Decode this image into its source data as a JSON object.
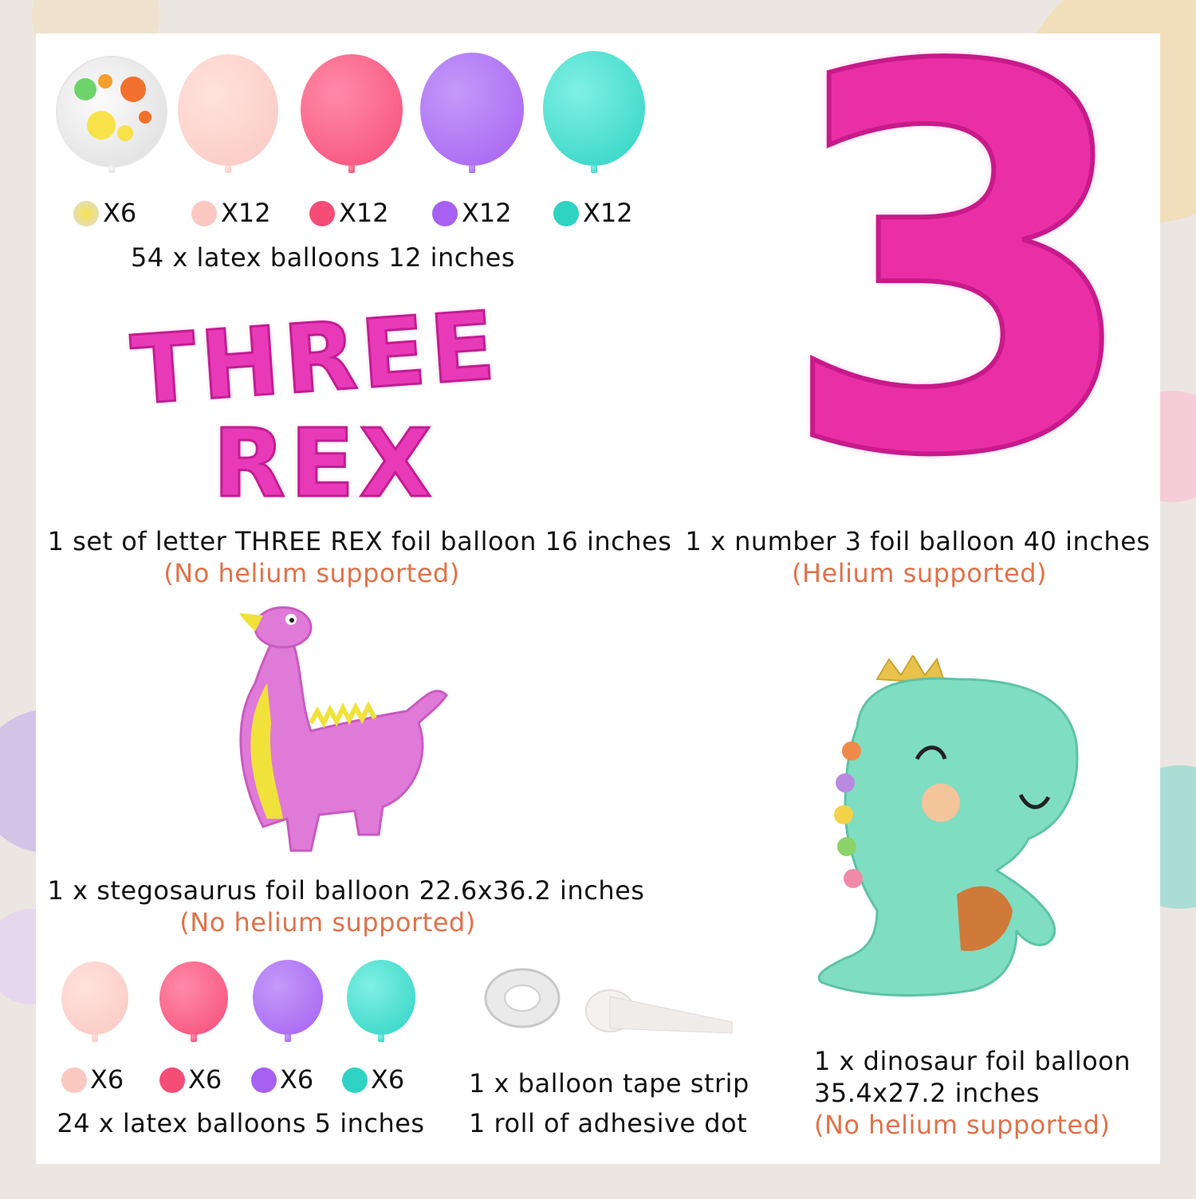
{
  "colors": {
    "peach": "#fbc8c1",
    "coral_pink": "#f64d78",
    "purple": "#a660f2",
    "teal": "#2fd3c3",
    "hot_pink": "#e83ab8",
    "note_orange": "#e0724a"
  },
  "latex12": {
    "counts": [
      "X6",
      "X12",
      "X12",
      "X12",
      "X12"
    ],
    "caption": "54 x latex balloons 12 inches"
  },
  "letters": {
    "word1": "THREE",
    "word2": "REX",
    "caption": "1 set of letter THREE REX foil balloon 16 inches",
    "note": "(No helium supported)"
  },
  "number3": {
    "digit": "3",
    "caption": "1 x number 3 foil balloon 40 inches",
    "note": "(Helium supported)"
  },
  "stegosaurus": {
    "caption": "1 x stegosaurus foil balloon 22.6x36.2  inches",
    "note": "(No helium supported)"
  },
  "dinosaur": {
    "caption_line1": "1 x dinosaur foil balloon",
    "caption_line2": "35.4x27.2 inches",
    "note": "(No helium supported)"
  },
  "latex5": {
    "counts": [
      "X6",
      "X6",
      "X6",
      "X6"
    ],
    "caption": "24 x latex balloons 5 inches"
  },
  "tape": {
    "line1": "1 x balloon tape strip",
    "line2": "1 roll of adhesive dot"
  }
}
